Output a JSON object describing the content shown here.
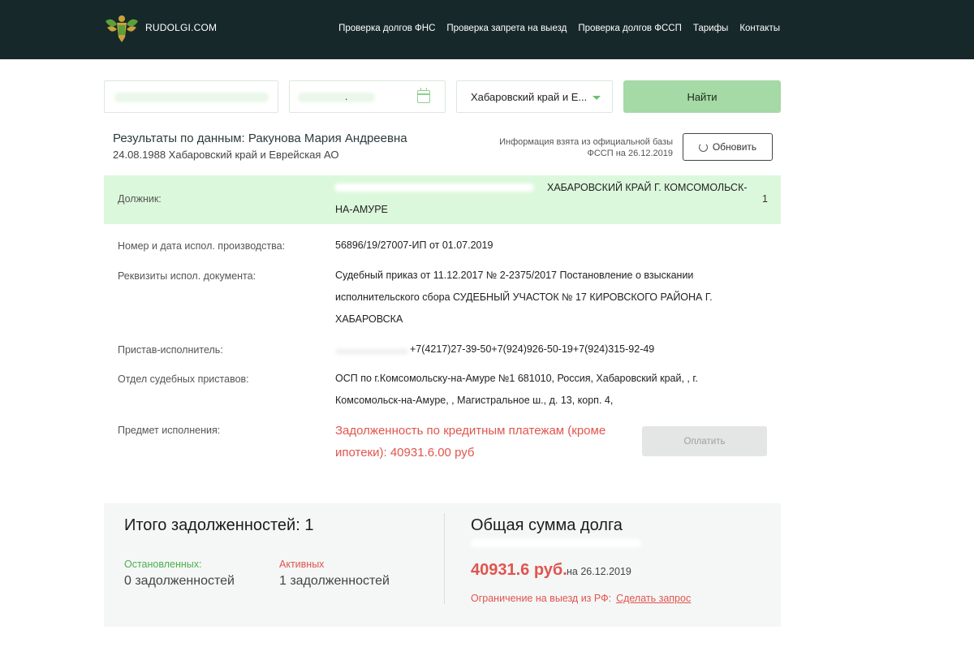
{
  "header": {
    "site_name": "RUDOLGI.COM",
    "nav": [
      "Проверка долгов ФНС",
      "Проверка запрета на выезд",
      "Проверка долгов ФССП",
      "Тарифы",
      "Контакты"
    ]
  },
  "search": {
    "date_separator": ".",
    "region_value": "Хабаровский край и Е...",
    "find_label": "Найти"
  },
  "results": {
    "title": "Результаты по данным: Ракунова Мария Андреевна",
    "subtitle": "24.08.1988 Хабаровский край и Еврейская АО",
    "info_note": "Информация взята из официальной базы ФССП на 26.12.2019",
    "refresh_label": "Обновить"
  },
  "debtor": {
    "label": "Должник:",
    "value_line1": "ХАБАРОВСКИЙ КРАЙ Г. КОМСОМОЛЬСК-",
    "value_line2": "НА-АМУРЕ",
    "count": "1"
  },
  "details": {
    "proceeding_label": "Номер и дата испол. производства:",
    "proceeding_value": "56896/19/27007-ИП от 01.07.2019",
    "document_label": "Реквизиты испол. документа:",
    "document_value": "Судебный приказ от 11.12.2017 № 2-2375/2017 Постановление о взыскании исполнительского сбора СУДЕБНЫЙ УЧАСТОК № 17 КИРОВСКОГО РАЙОНА Г. ХАБАРОВСКА",
    "bailiff_label": "Пристав-исполнитель:",
    "bailiff_value": "+7(4217)27-39-50+7(924)926-50-19+7(924)315-92-49",
    "department_label": "Отдел судебных приставов:",
    "department_value": "ОСП по г.Комсомольску-на-Амуре №1 681010, Россия, Хабаровский край, , г. Комсомольск-на-Амуре, , Магистральное ш., д. 13, корп. 4,",
    "subject_label": "Предмет исполнения:",
    "subject_value": "Задолженность по кредитным платежам (кроме ипотеки): 40931.6.00 руб",
    "pay_label": "Оплатить"
  },
  "summary": {
    "total_title": "Итого задолженностей: 1",
    "stopped_label": "Остановленных:",
    "stopped_value": "0 задолженностей",
    "active_label": "Активных",
    "active_value": "1 задолженностей",
    "sum_title": "Общая сумма долга",
    "amount": "40931.6 руб.",
    "date": "на 26.12.2019",
    "restriction_label": "Ограничение на выезд из РФ:",
    "restriction_link": "Сделать запрос"
  },
  "colors": {
    "header_bg": "#17282a",
    "accent_green": "#a5d9a5",
    "debtor_band": "#dcf8dc",
    "accent_red": "#e0554e",
    "stopped_green": "#4caf50"
  }
}
